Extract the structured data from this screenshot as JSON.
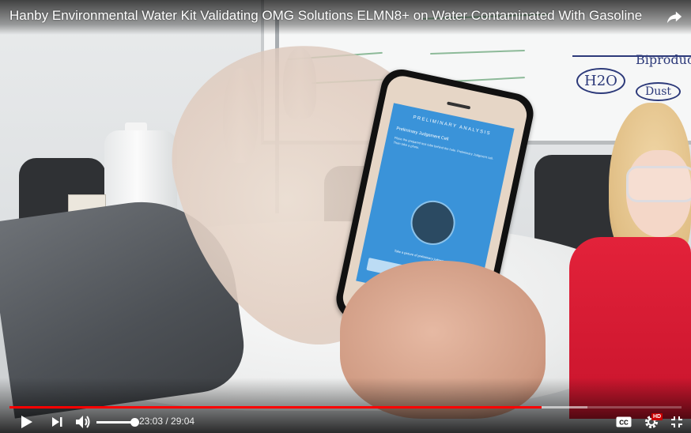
{
  "video": {
    "title": "Hanby Environmental Water Kit Validating OMG Solutions ELMN8+ on Water Contaminated With Gasoline",
    "progress_fraction": 0.792,
    "buffered_fraction": 0.86,
    "volume_fraction": 1.0
  },
  "controls": {
    "current_time": "23:03",
    "separator": " / ",
    "duration": "29:04",
    "play_icon": "play-icon",
    "next_icon": "next-icon",
    "volume_icon": "volume-icon",
    "cc_icon": "closed-captions-icon",
    "settings_icon": "settings-gear-icon",
    "hd_badge": "HD",
    "fullscreen_icon": "exit-fullscreen-icon",
    "share_icon": "share-icon"
  },
  "colors": {
    "progress_played": "#ff0000",
    "hd_badge": "#cc0000"
  }
}
